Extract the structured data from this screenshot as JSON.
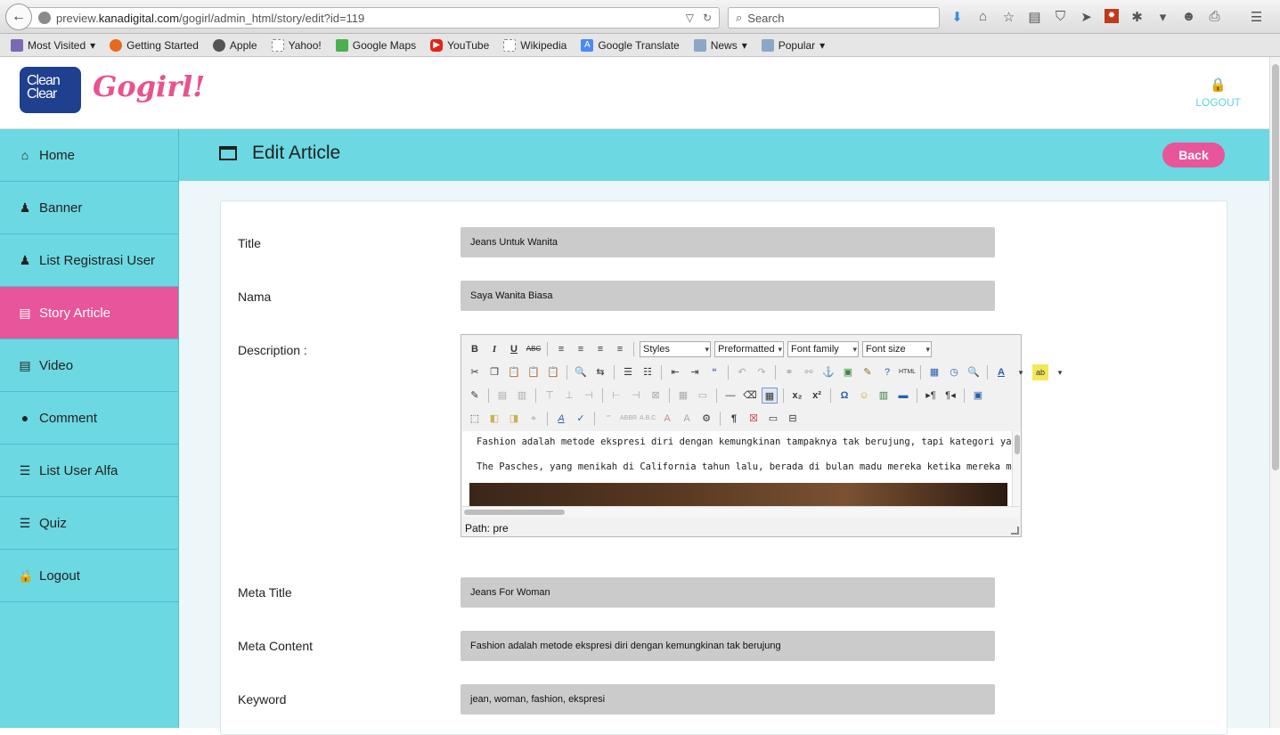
{
  "browser": {
    "url_prefix": "preview.",
    "url_domain": "kanadigital.com",
    "url_path": "/gogirl/admin_html/story/edit?id=119",
    "search_placeholder": "Search"
  },
  "bookmarks": [
    {
      "label": "Most Visited",
      "icon": "folder-icon",
      "color": "#7b6ab3",
      "dropdown": "▾"
    },
    {
      "label": "Getting Started",
      "icon": "firefox-icon",
      "color": "#e66a1e",
      "dropdown": ""
    },
    {
      "label": "Apple",
      "icon": "apple-icon",
      "color": "#555555",
      "dropdown": ""
    },
    {
      "label": "Yahoo!",
      "icon": "blank-page-icon",
      "color": "#ffffff",
      "dropdown": ""
    },
    {
      "label": "Google Maps",
      "icon": "maps-icon",
      "color": "#4caf50",
      "dropdown": ""
    },
    {
      "label": "YouTube",
      "icon": "youtube-icon",
      "color": "#e62117",
      "dropdown": ""
    },
    {
      "label": "Wikipedia",
      "icon": "blank-page-icon",
      "color": "#ffffff",
      "dropdown": ""
    },
    {
      "label": "Google Translate",
      "icon": "translate-icon",
      "color": "#4a8af4",
      "dropdown": ""
    },
    {
      "label": "News",
      "icon": "folder-icon",
      "color": "#8aa7c8",
      "dropdown": "▾"
    },
    {
      "label": "Popular",
      "icon": "folder-icon",
      "color": "#8aa7c8",
      "dropdown": "▾"
    }
  ],
  "brand": {
    "logo_line1": "Clean",
    "logo_line2": "Clear",
    "name": "Gogirl!",
    "logout": "LOGOUT"
  },
  "sidebar": {
    "items": [
      {
        "label": "Home",
        "icon": "home-icon",
        "glyph": "⌂"
      },
      {
        "label": "Banner",
        "icon": "user-icon",
        "glyph": "♟"
      },
      {
        "label": "List Registrasi User",
        "icon": "user-icon",
        "glyph": "♟"
      },
      {
        "label": "Story Article",
        "icon": "document-icon",
        "glyph": "▤"
      },
      {
        "label": "Video",
        "icon": "document-icon",
        "glyph": "▤"
      },
      {
        "label": "Comment",
        "icon": "comment-icon",
        "glyph": "●"
      },
      {
        "label": "List User Alfa",
        "icon": "list-icon",
        "glyph": "☰"
      },
      {
        "label": "Quiz",
        "icon": "list-icon",
        "glyph": "☰"
      },
      {
        "label": "Logout",
        "icon": "lock-icon",
        "glyph": "🔒"
      }
    ],
    "active": "Story Article"
  },
  "page": {
    "title": "Edit Article",
    "back_label": "Back"
  },
  "form": {
    "title_label": "Title",
    "title_value": "Jeans Untuk Wanita",
    "nama_label": "Nama",
    "nama_value": "Saya Wanita Biasa",
    "description_label": "Description :",
    "meta_title_label": "Meta Title",
    "meta_title_value": "Jeans For Woman",
    "meta_content_label": "Meta Content",
    "meta_content_value": "Fashion adalah metode ekspresi diri dengan kemungkinan tak berujung",
    "keyword_label": "Keyword",
    "keyword_value": "jean, woman, fashion, ekspresi"
  },
  "editor": {
    "styles": "Styles",
    "format": "Preformatted",
    "font_family": "Font family",
    "font_size": "Font size",
    "line1": "Fashion adalah metode ekspresi diri dengan kemungkinan tampaknya tak berujung, tapi kategori yang sering kaku: m",
    "line2": "The Pasches, yang menikah di California tahun lalu, berada di bulan madu mereka ketika mereka memimpikan gagasa",
    "path": "Path: pre"
  },
  "colors": {
    "accent_cyan": "#6cd8e1",
    "accent_pink": "#e9559a",
    "input_gray": "#cbcbcb"
  }
}
